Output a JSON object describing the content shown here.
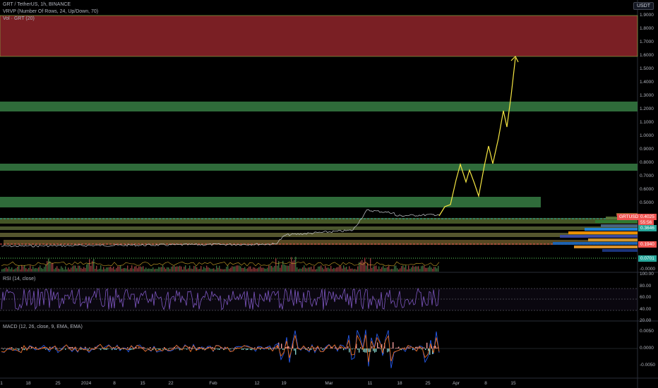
{
  "header": {
    "symbol_line": "GRT / TetherUS, 1h, BINANCE",
    "vrvp_line": "VRVP (Number Of Rows, 24, Up/Down, 70)",
    "vol_line": "Vol · GRT (20)"
  },
  "currency_button": "USDT",
  "price_axis": {
    "ticks": [
      "1.9000",
      "1.8000",
      "1.7000",
      "1.6000",
      "1.5000",
      "1.4000",
      "1.3000",
      "1.2000",
      "1.1000",
      "1.0000",
      "0.9000",
      "0.8000",
      "0.7000",
      "0.6000",
      "0.5000",
      "0.4000",
      "0.3000"
    ],
    "ticker_badge": "GRTUSDT",
    "last_price": "0.4025",
    "countdown": "55:56",
    "green_level": "0.3646",
    "red_level": "0.1940",
    "bottom_level": "0.0701",
    "zero_label": "-0.0000"
  },
  "rsi_pane": {
    "label": "RSI (14, close)",
    "ticks": [
      "100.00",
      "80.00",
      "60.00",
      "40.00",
      "20.00"
    ]
  },
  "macd_pane": {
    "label": "MACD (12, 26, close, 9, EMA, EMA)",
    "ticks": [
      "0.0050",
      "0.0000",
      "-0.0050"
    ]
  },
  "time_axis": [
    "1",
    "18",
    "25",
    "2024",
    "8",
    "15",
    "22",
    "Feb",
    "12",
    "19",
    "Mar",
    "11",
    "18",
    "25",
    "Apr",
    "8",
    "15"
  ],
  "colors": {
    "background": "#000000",
    "supply_zone": "#7a1f24",
    "demand_zone": "#2f6b3a",
    "projection": "#f5e642",
    "rsi_line": "#7e57c2",
    "macd_line": "#2962ff",
    "signal_line": "#ff6d00",
    "green_badge": "#26a69a",
    "red_badge": "#ef5350"
  }
}
